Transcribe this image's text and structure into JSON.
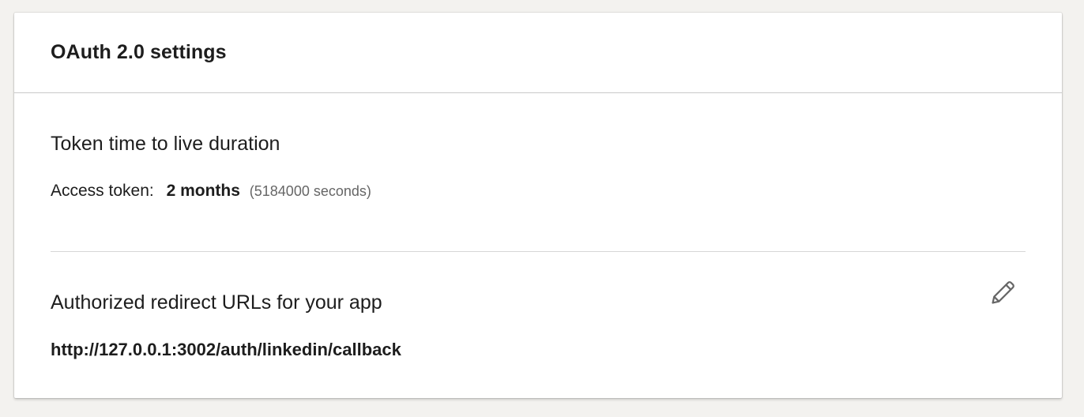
{
  "card": {
    "title": "OAuth 2.0 settings"
  },
  "token_ttl": {
    "heading": "Token time to live duration",
    "access_token_label": "Access token:",
    "access_token_duration": "2 months",
    "access_token_seconds": "(5184000 seconds)"
  },
  "redirect": {
    "heading": "Authorized redirect URLs for your app",
    "urls": [
      "http://127.0.0.1:3002/auth/linkedin/callback"
    ],
    "edit_icon": "pencil-icon"
  },
  "colors": {
    "page_background": "#f3f2ef",
    "card_background": "#ffffff",
    "text_primary": "#1d1d1d",
    "text_secondary": "#666666",
    "divider": "#d6d6d6",
    "icon": "#666666"
  }
}
